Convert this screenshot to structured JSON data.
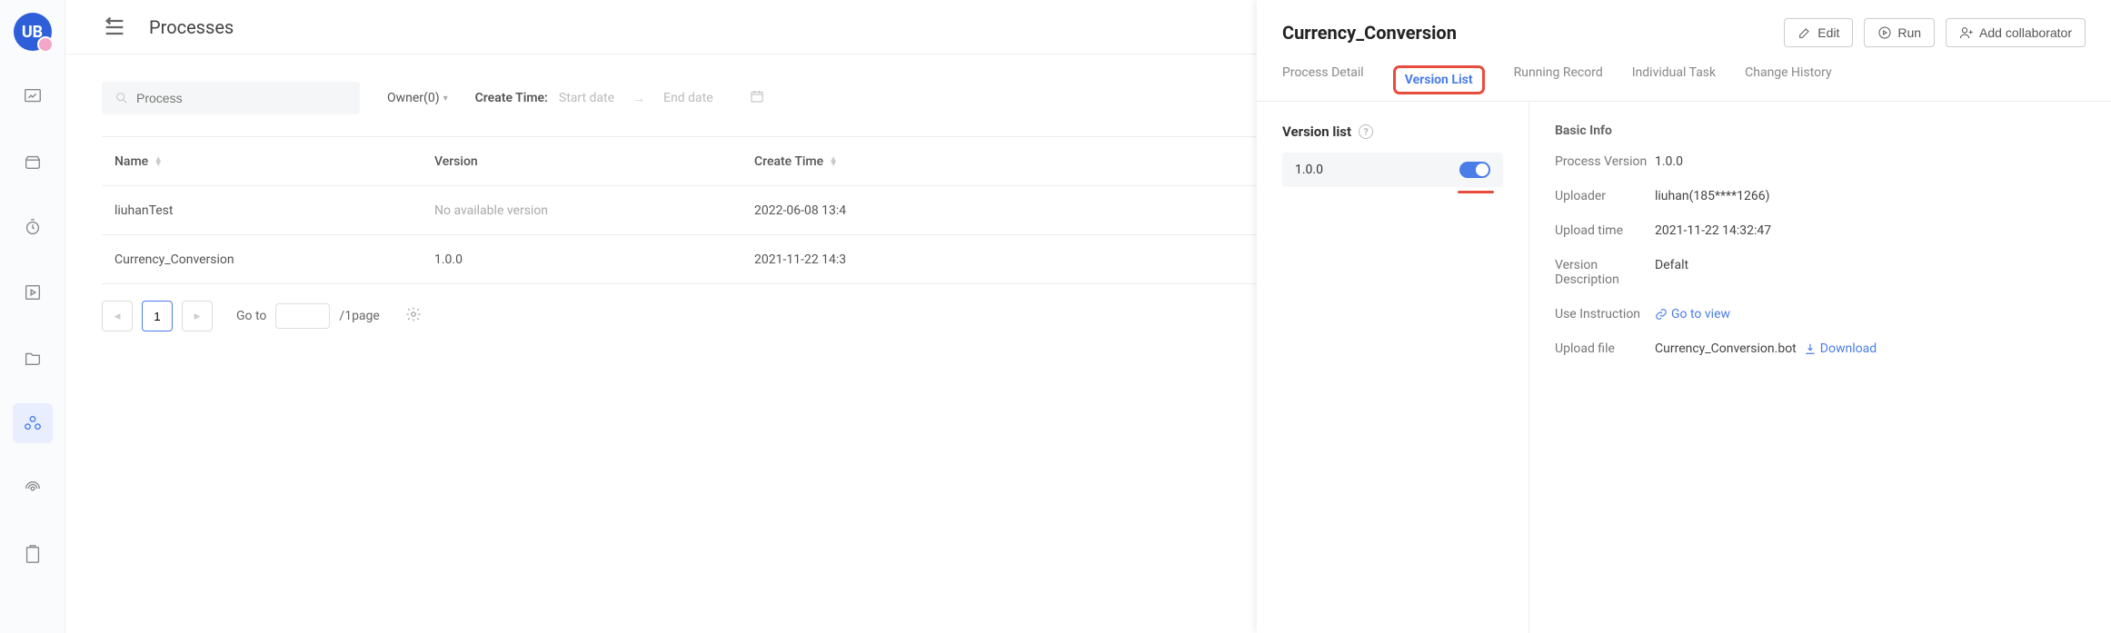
{
  "page": {
    "title": "Processes"
  },
  "filters": {
    "searchPlaceholder": "Process",
    "ownerLabel": "Owner(0)",
    "createTimeLabel": "Create Time:",
    "startDatePh": "Start date",
    "endDatePh": "End date"
  },
  "table": {
    "columns": {
      "name": "Name",
      "version": "Version",
      "createTime": "Create Time"
    },
    "rows": [
      {
        "name": "liuhanTest",
        "version": "No available version",
        "createTime": "2022-06-08 13:4"
      },
      {
        "name": "Currency_Conversion",
        "version": "1.0.0",
        "createTime": "2021-11-22 14:3"
      }
    ]
  },
  "pagination": {
    "currentPage": "1",
    "goToLabel": "Go to",
    "pageSuffix": "/1page"
  },
  "panel": {
    "title": "Currency_Conversion",
    "buttons": {
      "edit": "Edit",
      "run": "Run",
      "addCollaborator": "Add collaborator"
    },
    "tabs": {
      "processDetail": "Process Detail",
      "versionList": "Version List",
      "runningRecord": "Running Record",
      "individualTask": "Individual Task",
      "changeHistory": "Change History"
    },
    "versionList": {
      "heading": "Version list",
      "items": [
        {
          "version": "1.0.0",
          "enabled": true
        }
      ]
    },
    "basicInfo": {
      "heading": "Basic Info",
      "processVersionLabel": "Process Version",
      "processVersion": "1.0.0",
      "uploaderLabel": "Uploader",
      "uploader": "liuhan(185****1266)",
      "uploadTimeLabel": "Upload time",
      "uploadTime": "2021-11-22 14:32:47",
      "descriptionLabel": "Version Description",
      "description": "Defalt",
      "instructionLabel": "Use Instruction",
      "goToView": "Go to view",
      "uploadFileLabel": "Upload file",
      "fileName": "Currency_Conversion.bot",
      "download": "Download"
    }
  }
}
